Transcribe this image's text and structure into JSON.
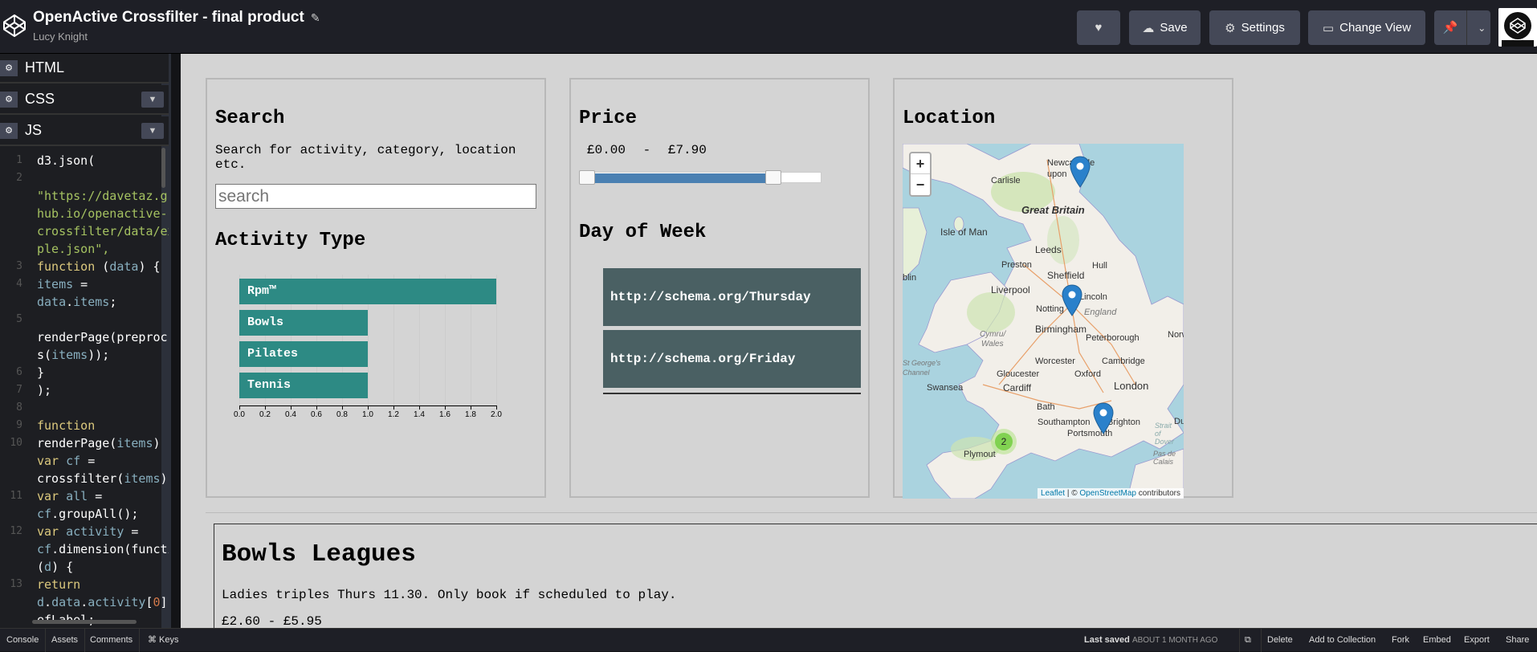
{
  "header": {
    "title": "OpenActive Crossfilter - final product",
    "author": "Lucy Knight",
    "buttons": {
      "save": "Save",
      "settings": "Settings",
      "change_view": "Change View"
    }
  },
  "editor": {
    "panels": [
      "HTML",
      "CSS",
      "JS"
    ],
    "code_lines": [
      {
        "n": "1",
        "text": "d3.json("
      },
      {
        "n": "2",
        "text": ""
      },
      {
        "n": "",
        "text": " \"https://davetaz.g"
      },
      {
        "n": "",
        "text": "hub.io/openactive-"
      },
      {
        "n": "",
        "text": "crossfilter/data/ex"
      },
      {
        "n": "",
        "text": "ple.json\","
      },
      {
        "n": "3",
        "text": "  function (data) {"
      },
      {
        "n": "4",
        "text": "    items ="
      },
      {
        "n": "",
        "text": "data.items;"
      },
      {
        "n": "5",
        "text": ""
      },
      {
        "n": "",
        "text": " renderPage(preproc"
      },
      {
        "n": "",
        "text": "s(items));"
      },
      {
        "n": "6",
        "text": "  }"
      },
      {
        "n": "7",
        "text": ");"
      },
      {
        "n": "8",
        "text": ""
      },
      {
        "n": "9",
        "text": "function"
      },
      {
        "n": "10",
        "text": "renderPage(items) {"
      },
      {
        "n": "",
        "text": "  var cf ="
      },
      {
        "n": "",
        "text": "crossfilter(items);"
      },
      {
        "n": "11",
        "text": "  var all ="
      },
      {
        "n": "",
        "text": "cf.groupAll();"
      },
      {
        "n": "12",
        "text": "  var activity ="
      },
      {
        "n": "",
        "text": "cf.dimension(functi"
      },
      {
        "n": "",
        "text": "(d) {"
      },
      {
        "n": "13",
        "text": "    return"
      },
      {
        "n": "",
        "text": "d.data.activity[0]"
      },
      {
        "n": "",
        "text": "efLabel;"
      }
    ]
  },
  "search": {
    "heading": "Search",
    "description": "Search for activity, category, location etc.",
    "placeholder": "search"
  },
  "activity": {
    "heading": "Activity Type"
  },
  "chart_data": {
    "type": "bar",
    "orientation": "horizontal",
    "categories": [
      "Rpm™",
      "Bowls",
      "Pilates",
      "Tennis"
    ],
    "values": [
      2.0,
      1.0,
      1.0,
      1.0
    ],
    "xlim": [
      0,
      2.0
    ],
    "ticks": [
      "0.0",
      "0.2",
      "0.4",
      "0.6",
      "0.8",
      "1.0",
      "1.2",
      "1.4",
      "1.6",
      "1.8",
      "2.0"
    ],
    "bar_color": "#2d8a84"
  },
  "price": {
    "heading": "Price",
    "min_label": "£0.00",
    "separator": "-",
    "max_label": "£7.90",
    "range_fraction": [
      0.0,
      0.8
    ]
  },
  "day_of_week": {
    "heading": "Day of Week",
    "days": [
      "http://schema.org/Thursday",
      "http://schema.org/Friday"
    ]
  },
  "location": {
    "heading": "Location",
    "zoom_in": "+",
    "zoom_out": "−",
    "cluster_count": "2",
    "labels": {
      "newcastle_1": "Newca",
      "newcastle_2": "tle",
      "newcastle_3": "upon",
      "newcastle_4": "ne",
      "carlisle": "Carlisle",
      "great_britain": "Great Britain",
      "isle_of_man": "Isle of Man",
      "leeds": "Leeds",
      "preston": "Preston",
      "hull": "Hull",
      "sheffield": "Sheffield",
      "liverpool": "Liverpool",
      "blin": "blin",
      "lincoln": "Lincoln",
      "nottingham": "Notting",
      "england": "England",
      "birmingham": "Birmingham",
      "norw": "Norw",
      "peterborough": "Peterborough",
      "cymru_1": "Cymru",
      "cymru_2": "Wales",
      "worcester": "Worcester",
      "cambridge": "Cambridge",
      "st_georges_1": "St George's",
      "st_georges_2": "Channel",
      "gloucester": "Gloucester",
      "oxford": "Oxford",
      "london": "London",
      "swansea": "Swansea",
      "cardiff": "Cardiff",
      "bath": "Bath",
      "southampton": "Southampton",
      "brighton": "Brighton",
      "portsmouth": "Portsmouth",
      "plymouth": "Plymout",
      "strait_1": "Strait",
      "strait_2": "of",
      "strait_3": "Dover",
      "pas_1": "Pas",
      "pas_2": "de",
      "pas_3": "Calais",
      "du": "Du"
    },
    "attribution": {
      "leaflet": "Leaflet",
      "sep": " | © ",
      "osm": "OpenStreetMap",
      "contrib": " contributors"
    }
  },
  "result": {
    "title": "Bowls Leagues",
    "description": "Ladies triples Thurs 11.30. Only book if scheduled to play.",
    "price": "£2.60 - £5.95"
  },
  "footer": {
    "left": [
      "Console",
      "Assets",
      "Comments",
      "⌘ Keys"
    ],
    "last_saved_label": "Last saved",
    "last_saved_value": "ABOUT 1 MONTH AGO",
    "right": [
      "Delete",
      "Add to Collection",
      "Fork",
      "Embed",
      "Export",
      "Share"
    ]
  },
  "colors": {
    "header_bg": "#1e1f26",
    "button_bg": "#444857",
    "preview_bg": "#d4d4d4",
    "bar": "#2d8a84",
    "day_block": "#4a6063",
    "slider_fill": "#4a80b2",
    "marker": "#2a81cb",
    "cluster": "#6ecc39"
  }
}
